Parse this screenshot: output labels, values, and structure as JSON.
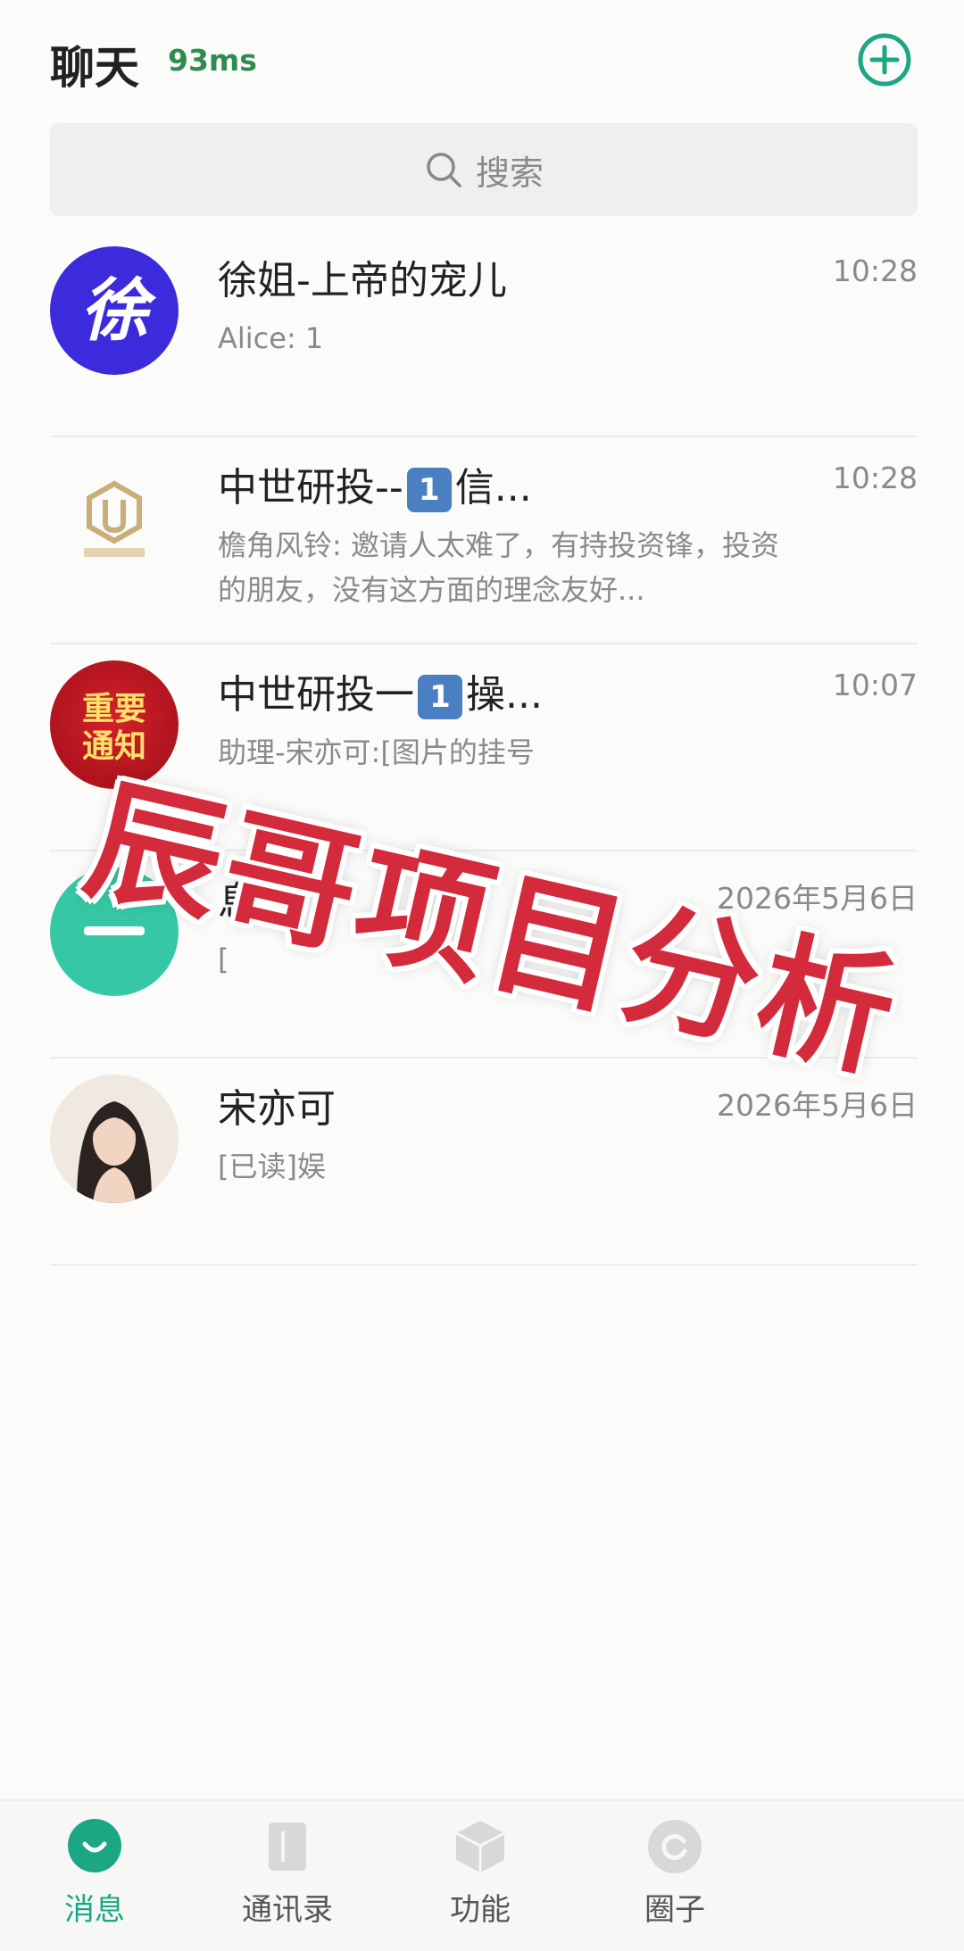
{
  "header": {
    "title": "聊天",
    "latency": "93ms"
  },
  "search": {
    "label": "搜索"
  },
  "chats": [
    {
      "avatar": "徐",
      "title": "徐姐-上帝的宠儿",
      "time": "10:28",
      "preview": "Alice: 1"
    },
    {
      "title_prefix": "中世研投--",
      "badge": "1",
      "title_suffix": "信...",
      "time": "10:28",
      "preview": "檐角风铃: 邀请人太难了，有持投资锋，投资的朋友，没有这方面的理念友好..."
    },
    {
      "avatar_lines": [
        "重要",
        "通知"
      ],
      "title_prefix": "中世研投一",
      "badge": "1",
      "title_suffix": "操...",
      "time": "10:07",
      "preview": "助理-宋亦可:[图片的挂号"
    },
    {
      "title": "息",
      "time": "2026年5月6日",
      "preview": "["
    },
    {
      "title": "宋亦可",
      "time": "2026年5月6日",
      "preview": "[已读]娱"
    }
  ],
  "overlay": {
    "text": "辰哥项目分析"
  },
  "tabs": [
    {
      "label": "消息",
      "icon": "message-bubble-icon",
      "active": true
    },
    {
      "label": "通讯录",
      "icon": "contacts-book-icon",
      "active": false
    },
    {
      "label": "功能",
      "icon": "cube-icon",
      "active": false
    },
    {
      "label": "圈子",
      "icon": "circle-refresh-icon",
      "active": false
    }
  ],
  "colors": {
    "accent": "#1ba784",
    "badge": "#4a7fc2",
    "overlay": "#d42b3c",
    "avatar1": "#3b2bdc"
  }
}
